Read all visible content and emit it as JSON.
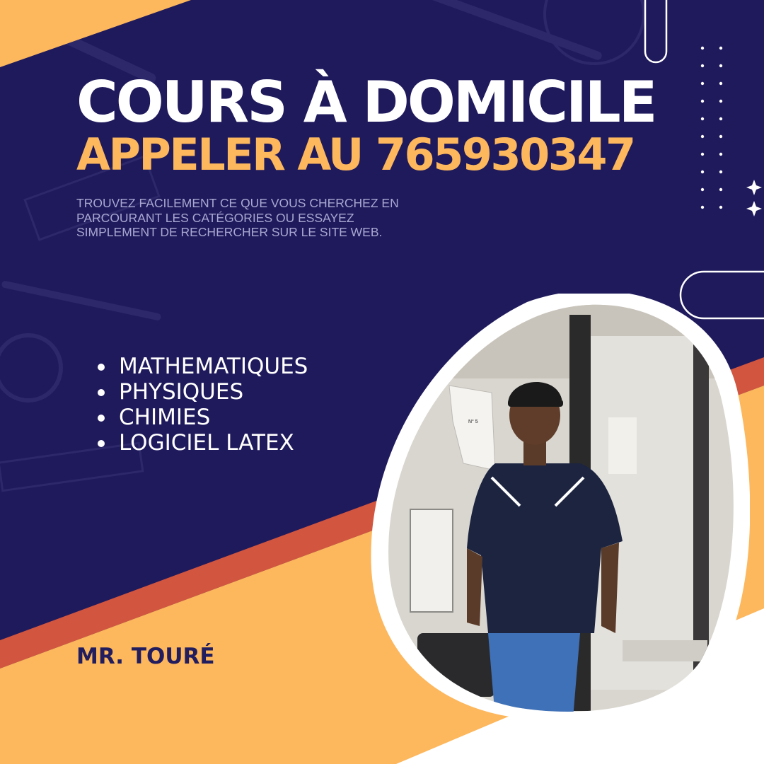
{
  "header": {
    "title": "COURS À DOMICILE",
    "phone": "APPELER AU 765930347"
  },
  "tagline": "TROUVEZ FACILEMENT CE QUE VOUS CHERCHEZ EN PARCOURANT LES CATÉGORIES OU ESSAYEZ SIMPLEMENT DE RECHERCHER SUR LE SITE WEB.",
  "subjects": [
    {
      "label": "MATHEMATIQUES"
    },
    {
      "label": "PHYSIQUES"
    },
    {
      "label": "CHIMIES"
    },
    {
      "label": "LOGICIEL LATEX"
    }
  ],
  "tutor": {
    "name": "MR. TOURÉ"
  },
  "photo": {
    "poster_label": "N° 5"
  },
  "colors": {
    "navy": "#1f1a5c",
    "gold": "#fdb75c",
    "orange_red": "#d2553f",
    "white": "#ffffff"
  },
  "icons": [
    "sparkle-icon",
    "dot-grid-decoration",
    "pill-outline-decoration"
  ]
}
